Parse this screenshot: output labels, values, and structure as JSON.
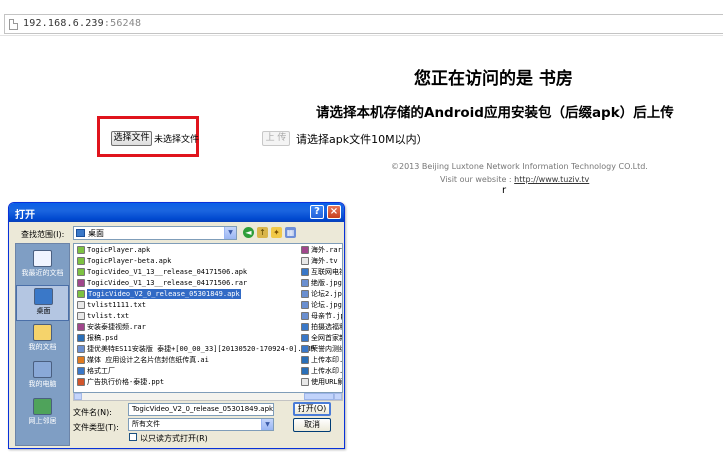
{
  "address_bar": {
    "host": "192.168.6.239",
    "port": ":56248"
  },
  "page": {
    "visit_title": "您正在访问的是 书房",
    "instruction": "请选择本机存储的Android应用安装包（后缀apk）后上传",
    "file_input": {
      "button_label": "选择文件",
      "status": "未选择文件"
    },
    "upload_button": "上 传",
    "size_hint": "请选择apk文件10M以内）",
    "copyright": "©2013 Beijing Luxtone Network Information Technology CO.Ltd.",
    "visit_label": "Visit our website :",
    "website": "http://www.tuziv.tv",
    "stray_char": "r"
  },
  "dialog": {
    "title": "打开",
    "help": "?",
    "close": "×",
    "look_in_label": "查找范围(I):",
    "look_in_value": "桌面",
    "places": [
      {
        "label": "我最近的文档",
        "color": "#f0f4ff"
      },
      {
        "label": "桌面",
        "color": "#3a78c8"
      },
      {
        "label": "我的文档",
        "color": "#f5d36b"
      },
      {
        "label": "我的电脑",
        "color": "#8aa9d8"
      },
      {
        "label": "网上邻居",
        "color": "#4fa35b"
      }
    ],
    "files_left": [
      {
        "name": "TogicPlayer.apk",
        "color": "#7dc242"
      },
      {
        "name": "TogicPlayer-beta.apk",
        "color": "#7dc242"
      },
      {
        "name": "TogicVideo_V1_13__release_04171506.apk",
        "color": "#7dc242"
      },
      {
        "name": "TogicVideo_V1_13__release_04171506.rar",
        "color": "#a0468c"
      },
      {
        "name": "TogicVideo_V2_0_release_05301849.apk",
        "color": "#7dc242",
        "selected": true
      },
      {
        "name": "tvlist1111.txt",
        "color": "#e8e8e8"
      },
      {
        "name": "tvlist.txt",
        "color": "#e8e8e8"
      },
      {
        "name": "安装泰捷视频.rar",
        "color": "#a0468c"
      },
      {
        "name": "报稿.psd",
        "color": "#2a6fb8"
      },
      {
        "name": "捷优美特ES11安装版 泰捷+[00_00_33][20130520-170924-0].BMP",
        "color": "#6a8fd0"
      },
      {
        "name": "媒体 应用设计之名片信封信纸传真.ai",
        "color": "#e07a1f"
      },
      {
        "name": "格式工厂",
        "color": "#3a78c8"
      },
      {
        "name": "广告执行价格-泰捷.ppt",
        "color": "#d2552b"
      }
    ],
    "files_right": [
      {
        "name": "海外.rar",
        "color": "#a0468c"
      },
      {
        "name": "海外.tv",
        "color": "#e8e8e8"
      },
      {
        "name": "互联网电视",
        "color": "#3a78c8"
      },
      {
        "name": "绝版.jpg",
        "color": "#6a8fd0"
      },
      {
        "name": "论坛2.jpg",
        "color": "#6a8fd0"
      },
      {
        "name": "论坛.jpg",
        "color": "#6a8fd0"
      },
      {
        "name": "母亲节.jpg",
        "color": "#6a8fd0"
      },
      {
        "name": "拍摄选福利",
        "color": "#3a78c8"
      },
      {
        "name": "全网首家新",
        "color": "#3a78c8"
      },
      {
        "name": "荣誉内测组",
        "color": "#3a78c8"
      },
      {
        "name": "上传本印.p",
        "color": "#2a6fb8"
      },
      {
        "name": "上传水印.p",
        "color": "#2a6fb8"
      },
      {
        "name": "使用URL解",
        "color": "#e8e8e8"
      }
    ],
    "filename_label": "文件名(N):",
    "filename_value": "TogicVideo_V2_0_release_05301849.apk",
    "filetype_label": "文件类型(T):",
    "filetype_value": "所有文件",
    "readonly_label": "以只读方式打开(R)",
    "open_button": "打开(O)",
    "cancel_button": "取消"
  }
}
